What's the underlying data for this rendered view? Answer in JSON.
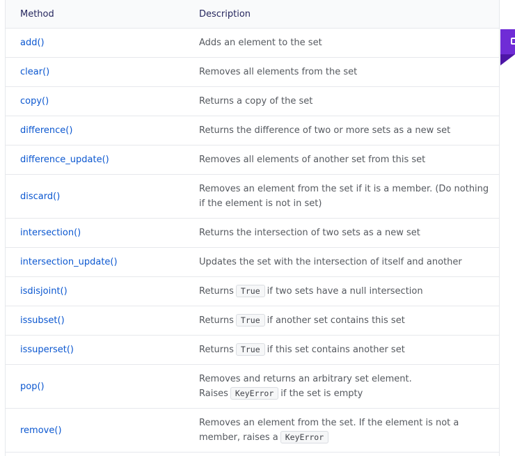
{
  "table": {
    "headers": {
      "method": "Method",
      "description": "Description"
    },
    "code_label": "True",
    "keyerror_label": "KeyError",
    "rows": [
      {
        "method": "add()",
        "description": "Adds an element to the set"
      },
      {
        "method": "clear()",
        "description": "Removes all elements from the set"
      },
      {
        "method": "copy()",
        "description": "Returns a copy of the set"
      },
      {
        "method": "difference()",
        "description": "Returns the difference of two or more sets as a new set"
      },
      {
        "method": "difference_update()",
        "description": "Removes all elements of another set from this set"
      },
      {
        "method": "discard()",
        "description": "Removes an element from the set if it is a member. (Do nothing if the element is not in set)"
      },
      {
        "method": "intersection()",
        "description": "Returns the intersection of two sets as a new set"
      },
      {
        "method": "intersection_update()",
        "description": "Updates the set with the intersection of itself and another"
      },
      {
        "method": "isdisjoint()",
        "description_before": "Returns",
        "description_after": "if two sets have a null intersection"
      },
      {
        "method": "issubset()",
        "description_before": "Returns",
        "description_after": "if another set contains this set"
      },
      {
        "method": "issuperset()",
        "description_before": "Returns",
        "description_after": "if this set contains another set"
      },
      {
        "method": "pop()",
        "description_before": "Removes and returns an arbitrary set element. Raises",
        "description_after": "if the set is empty"
      },
      {
        "method": "remove()",
        "description_before": "Removes an element from the set. If the element is not a member, raises a",
        "description_after": ""
      }
    ]
  },
  "colors": {
    "link": "#0b57d0",
    "header_bg": "#f9fafb",
    "accent": "#6f2cd6"
  }
}
